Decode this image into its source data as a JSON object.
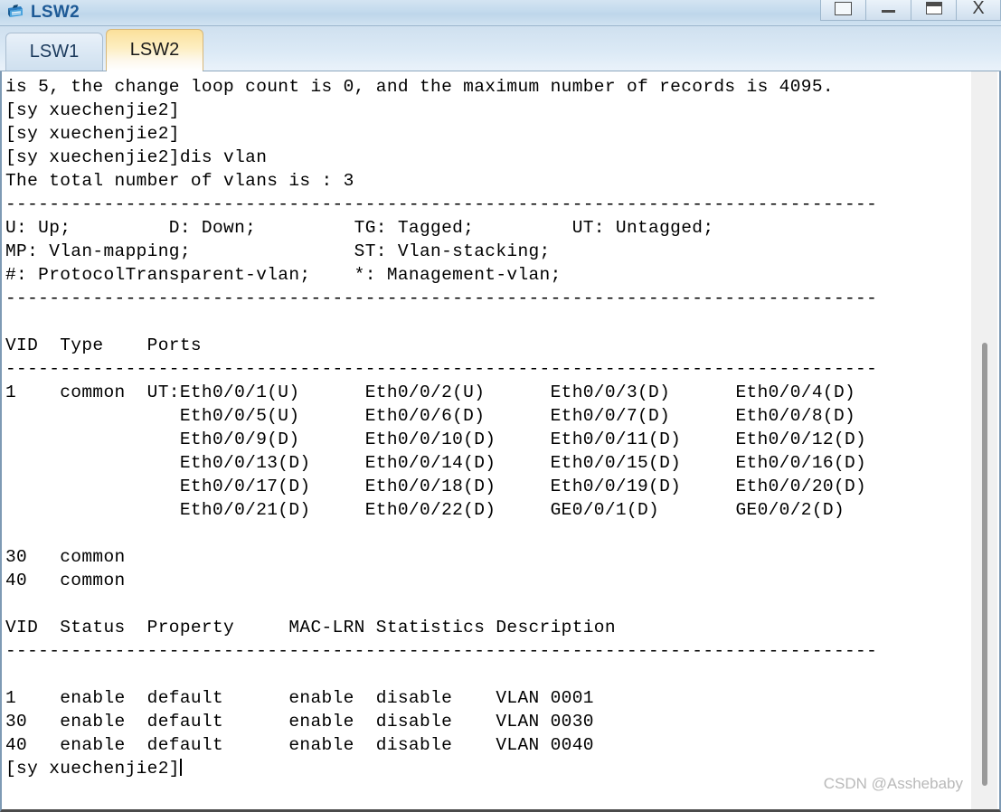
{
  "window": {
    "title": "LSW2",
    "icon": "switch-icon",
    "accent_color": "#1e5a96",
    "controls": [
      {
        "name": "restore-button",
        "glyph": "restore"
      },
      {
        "name": "minimize-button",
        "glyph": "minimize"
      },
      {
        "name": "maximize-button",
        "glyph": "maximize"
      },
      {
        "name": "close-button",
        "glyph": "X"
      }
    ]
  },
  "tabs": [
    {
      "label": "LSW1",
      "active": false
    },
    {
      "label": "LSW2",
      "active": true
    }
  ],
  "terminal": {
    "lines": [
      "is 5, the change loop count is 0, and the maximum number of records is 4095.",
      "[sy xuechenjie2]",
      "[sy xuechenjie2]",
      "[sy xuechenjie2]dis vlan",
      "The total number of vlans is : 3",
      "--------------------------------------------------------------------------------",
      "U: Up;         D: Down;         TG: Tagged;         UT: Untagged;",
      "MP: Vlan-mapping;               ST: Vlan-stacking;",
      "#: ProtocolTransparent-vlan;    *: Management-vlan;",
      "--------------------------------------------------------------------------------",
      "",
      "VID  Type    Ports",
      "--------------------------------------------------------------------------------",
      "1    common  UT:Eth0/0/1(U)      Eth0/0/2(U)      Eth0/0/3(D)      Eth0/0/4(D)",
      "                Eth0/0/5(U)      Eth0/0/6(D)      Eth0/0/7(D)      Eth0/0/8(D)",
      "                Eth0/0/9(D)      Eth0/0/10(D)     Eth0/0/11(D)     Eth0/0/12(D)",
      "                Eth0/0/13(D)     Eth0/0/14(D)     Eth0/0/15(D)     Eth0/0/16(D)",
      "                Eth0/0/17(D)     Eth0/0/18(D)     Eth0/0/19(D)     Eth0/0/20(D)",
      "                Eth0/0/21(D)     Eth0/0/22(D)     GE0/0/1(D)       GE0/0/2(D)",
      "",
      "30   common",
      "40   common",
      "",
      "VID  Status  Property     MAC-LRN Statistics Description",
      "--------------------------------------------------------------------------------",
      "",
      "1    enable  default      enable  disable    VLAN 0001",
      "30   enable  default      enable  disable    VLAN 0030",
      "40   enable  default      enable  disable    VLAN 0040",
      "[sy xuechenjie2]"
    ],
    "prompt_cursor_line_index": 29
  },
  "vlan_summary": {
    "total_vlans": 3,
    "max_records": 4095,
    "change_loop_count": 0,
    "legend": [
      {
        "key": "U",
        "meaning": "Up"
      },
      {
        "key": "D",
        "meaning": "Down"
      },
      {
        "key": "TG",
        "meaning": "Tagged"
      },
      {
        "key": "UT",
        "meaning": "Untagged"
      },
      {
        "key": "MP",
        "meaning": "Vlan-mapping"
      },
      {
        "key": "ST",
        "meaning": "Vlan-stacking"
      },
      {
        "key": "#",
        "meaning": "ProtocolTransparent-vlan"
      },
      {
        "key": "*",
        "meaning": "Management-vlan"
      }
    ],
    "ports_table": {
      "headers": [
        "VID",
        "Type",
        "Ports"
      ],
      "rows": [
        {
          "vid": "1",
          "type": "common",
          "ports": [
            "UT:Eth0/0/1(U)",
            "Eth0/0/2(U)",
            "Eth0/0/3(D)",
            "Eth0/0/4(D)",
            "Eth0/0/5(U)",
            "Eth0/0/6(D)",
            "Eth0/0/7(D)",
            "Eth0/0/8(D)",
            "Eth0/0/9(D)",
            "Eth0/0/10(D)",
            "Eth0/0/11(D)",
            "Eth0/0/12(D)",
            "Eth0/0/13(D)",
            "Eth0/0/14(D)",
            "Eth0/0/15(D)",
            "Eth0/0/16(D)",
            "Eth0/0/17(D)",
            "Eth0/0/18(D)",
            "Eth0/0/19(D)",
            "Eth0/0/20(D)",
            "Eth0/0/21(D)",
            "Eth0/0/22(D)",
            "GE0/0/1(D)",
            "GE0/0/2(D)"
          ]
        },
        {
          "vid": "30",
          "type": "common",
          "ports": []
        },
        {
          "vid": "40",
          "type": "common",
          "ports": []
        }
      ]
    },
    "status_table": {
      "headers": [
        "VID",
        "Status",
        "Property",
        "MAC-LRN",
        "Statistics",
        "Description"
      ],
      "rows": [
        [
          "1",
          "enable",
          "default",
          "enable",
          "disable",
          "VLAN 0001"
        ],
        [
          "30",
          "enable",
          "default",
          "enable",
          "disable",
          "VLAN 0030"
        ],
        [
          "40",
          "enable",
          "default",
          "enable",
          "disable",
          "VLAN 0040"
        ]
      ]
    }
  },
  "watermark": {
    "text": "CSDN @Asshebaby"
  }
}
